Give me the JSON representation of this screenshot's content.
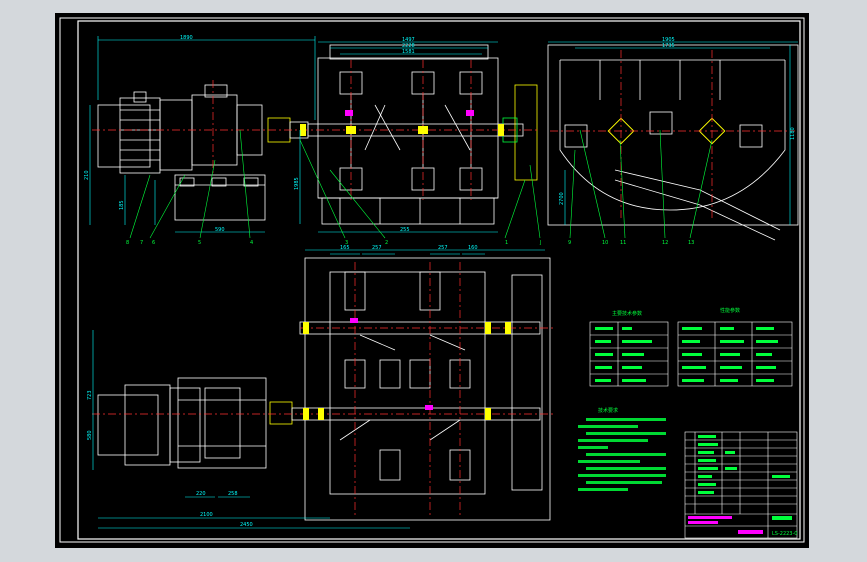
{
  "window": {
    "background": "#d4d8dc",
    "viewport_background": "#000000"
  },
  "colors": {
    "frame": "#ffffff",
    "geometry": "#ffffff",
    "dimension": "#00ffff",
    "center": "#ff3030",
    "leader": "#00ff3c",
    "component": "#ffff00",
    "accent": "#ff00ff"
  },
  "top_view": {
    "dims": [
      "1890",
      "1497",
      "2228",
      "1581",
      "1905",
      "1735",
      "1180",
      "210",
      "590",
      "1985",
      "255",
      "185",
      "2700"
    ],
    "part_numbers": [
      "8",
      "7",
      "6",
      "5",
      "4",
      "3",
      "2",
      "1",
      "J",
      "9",
      "10",
      "11",
      "12",
      "13"
    ]
  },
  "bottom_view": {
    "dims": [
      "165",
      "257",
      "257",
      "160",
      "2100",
      "2450",
      "723",
      "580",
      "220",
      "258"
    ]
  },
  "tables": {
    "left_title": "主要技术参数",
    "right_title": "性能参数"
  },
  "notes": {
    "title": "技术要求"
  },
  "title_block": {
    "drawing_no": "LS-2223-0"
  }
}
